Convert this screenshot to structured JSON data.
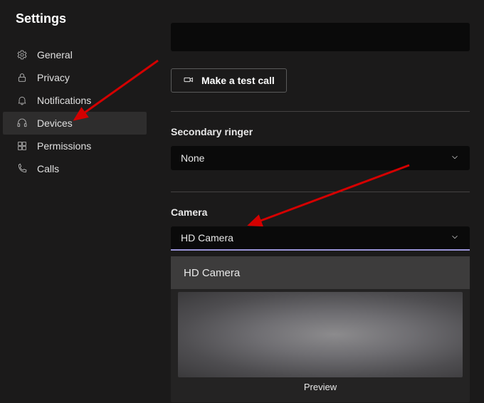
{
  "title": "Settings",
  "sidebar": {
    "items": [
      {
        "label": "General"
      },
      {
        "label": "Privacy"
      },
      {
        "label": "Notifications"
      },
      {
        "label": "Devices"
      },
      {
        "label": "Permissions"
      },
      {
        "label": "Calls"
      }
    ]
  },
  "content": {
    "test_call_label": "Make a test call",
    "secondary_ringer": {
      "label": "Secondary ringer",
      "value": "None"
    },
    "camera": {
      "label": "Camera",
      "value": "HD Camera",
      "options": [
        "HD Camera"
      ],
      "preview_label": "Preview"
    }
  }
}
